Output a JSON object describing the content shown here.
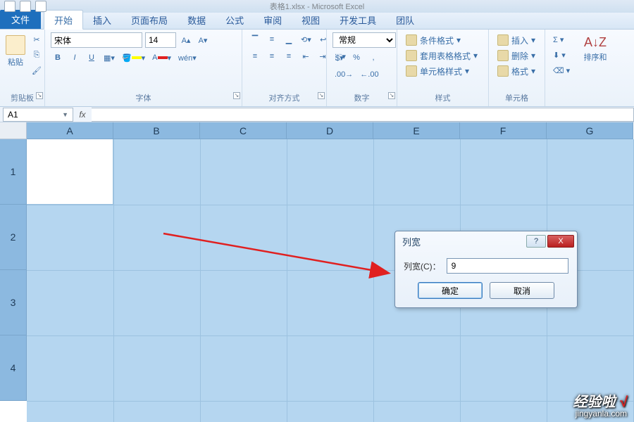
{
  "app_title": "表格1.xlsx - Microsoft Excel",
  "tabs": {
    "file": "文件",
    "home": "开始",
    "insert": "插入",
    "layout": "页面布局",
    "data": "数据",
    "formulas": "公式",
    "review": "审阅",
    "view": "视图",
    "developer": "开发工具",
    "team": "团队"
  },
  "ribbon": {
    "clipboard": {
      "label": "剪贴板",
      "paste": "粘贴"
    },
    "font": {
      "label": "字体",
      "name": "宋体",
      "size": "14",
      "bold": "B",
      "italic": "I",
      "underline": "U"
    },
    "alignment": {
      "label": "对齐方式"
    },
    "number": {
      "label": "数字",
      "format": "常规"
    },
    "styles": {
      "label": "样式",
      "conditional": "条件格式",
      "table": "套用表格格式",
      "cell": "单元格样式"
    },
    "cells": {
      "label": "单元格",
      "insert": "插入",
      "delete": "删除",
      "format": "格式"
    },
    "editing": {
      "label": "",
      "sort": "排序和"
    }
  },
  "namebox": "A1",
  "fx": "fx",
  "columns": [
    "A",
    "B",
    "C",
    "D",
    "E",
    "F",
    "G"
  ],
  "rows": [
    "1",
    "2",
    "3",
    "4"
  ],
  "dialog": {
    "title": "列宽",
    "label": "列宽(C)：",
    "value": "9",
    "ok": "确定",
    "cancel": "取消",
    "help": "?",
    "close": "X"
  },
  "watermark": {
    "main": "经验啦",
    "check": "√",
    "sub": "jingyanla.com"
  }
}
